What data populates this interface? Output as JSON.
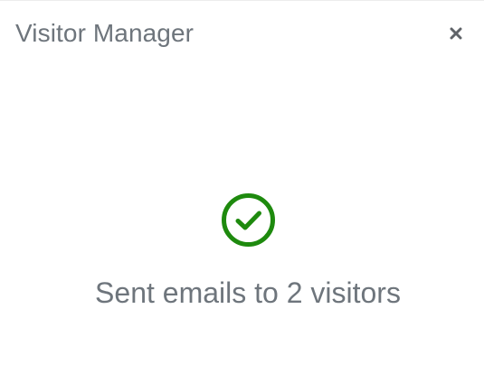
{
  "dialog": {
    "title": "Visitor Manager",
    "close_icon": "close-icon"
  },
  "status": {
    "icon": "check-circle-icon",
    "icon_color": "#1e8a0e",
    "message": "Sent emails to 2 visitors"
  },
  "colors": {
    "text": "#6e757c",
    "close": "#5f6368",
    "success": "#1e8a0e"
  }
}
